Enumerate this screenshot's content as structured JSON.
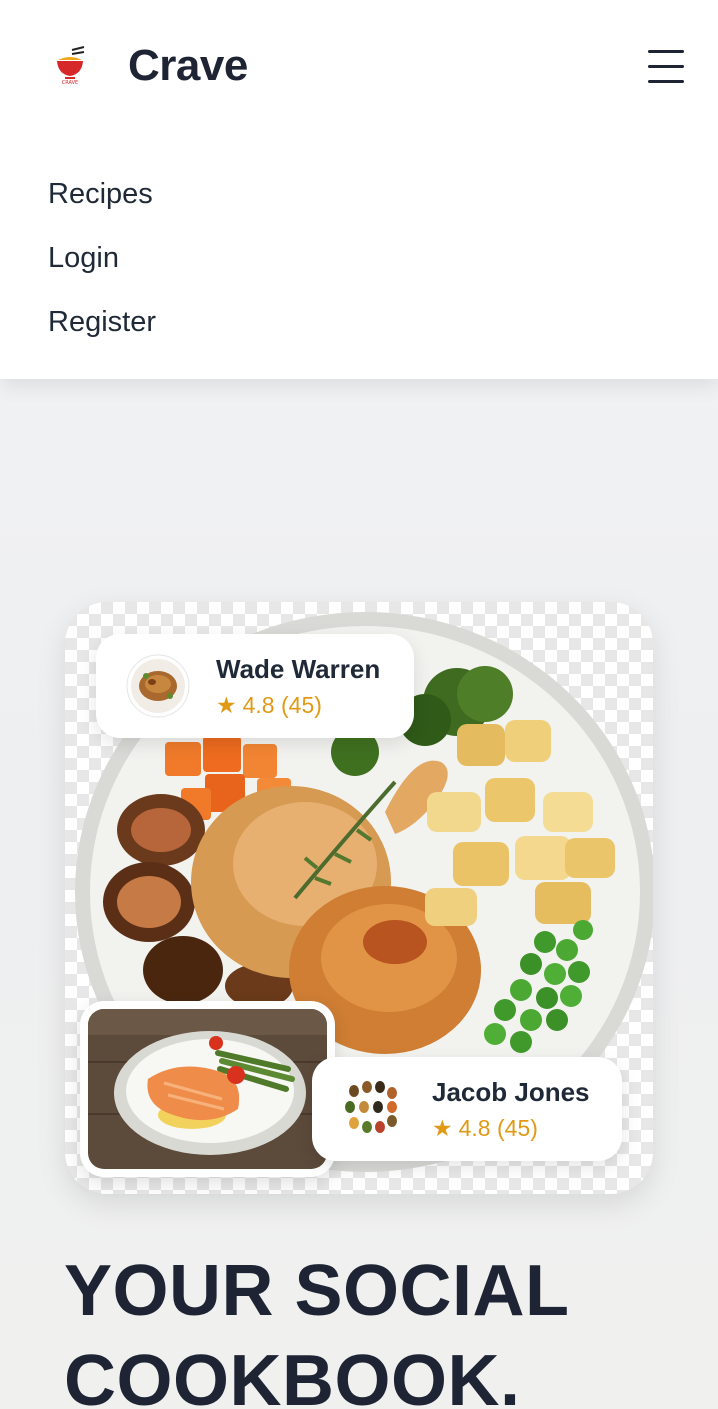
{
  "app": {
    "brand": "Crave"
  },
  "nav": {
    "links": [
      {
        "label": "Recipes"
      },
      {
        "label": "Login"
      },
      {
        "label": "Register"
      }
    ]
  },
  "hero": {
    "cards": [
      {
        "name": "Wade Warren",
        "rating": "4.8 (45)"
      },
      {
        "name": "Jacob Jones",
        "rating": "4.8 (45)"
      }
    ],
    "headline_line1": "YOUR SOCIAL",
    "headline_line2": "COOKBOOK."
  },
  "icons": {
    "logo": "noodle-bowl-logo",
    "menu": "hamburger-icon",
    "star": "star-icon"
  },
  "colors": {
    "brand_text": "#1e2433",
    "rating": "#e09a16",
    "logo_red": "#d62828"
  }
}
